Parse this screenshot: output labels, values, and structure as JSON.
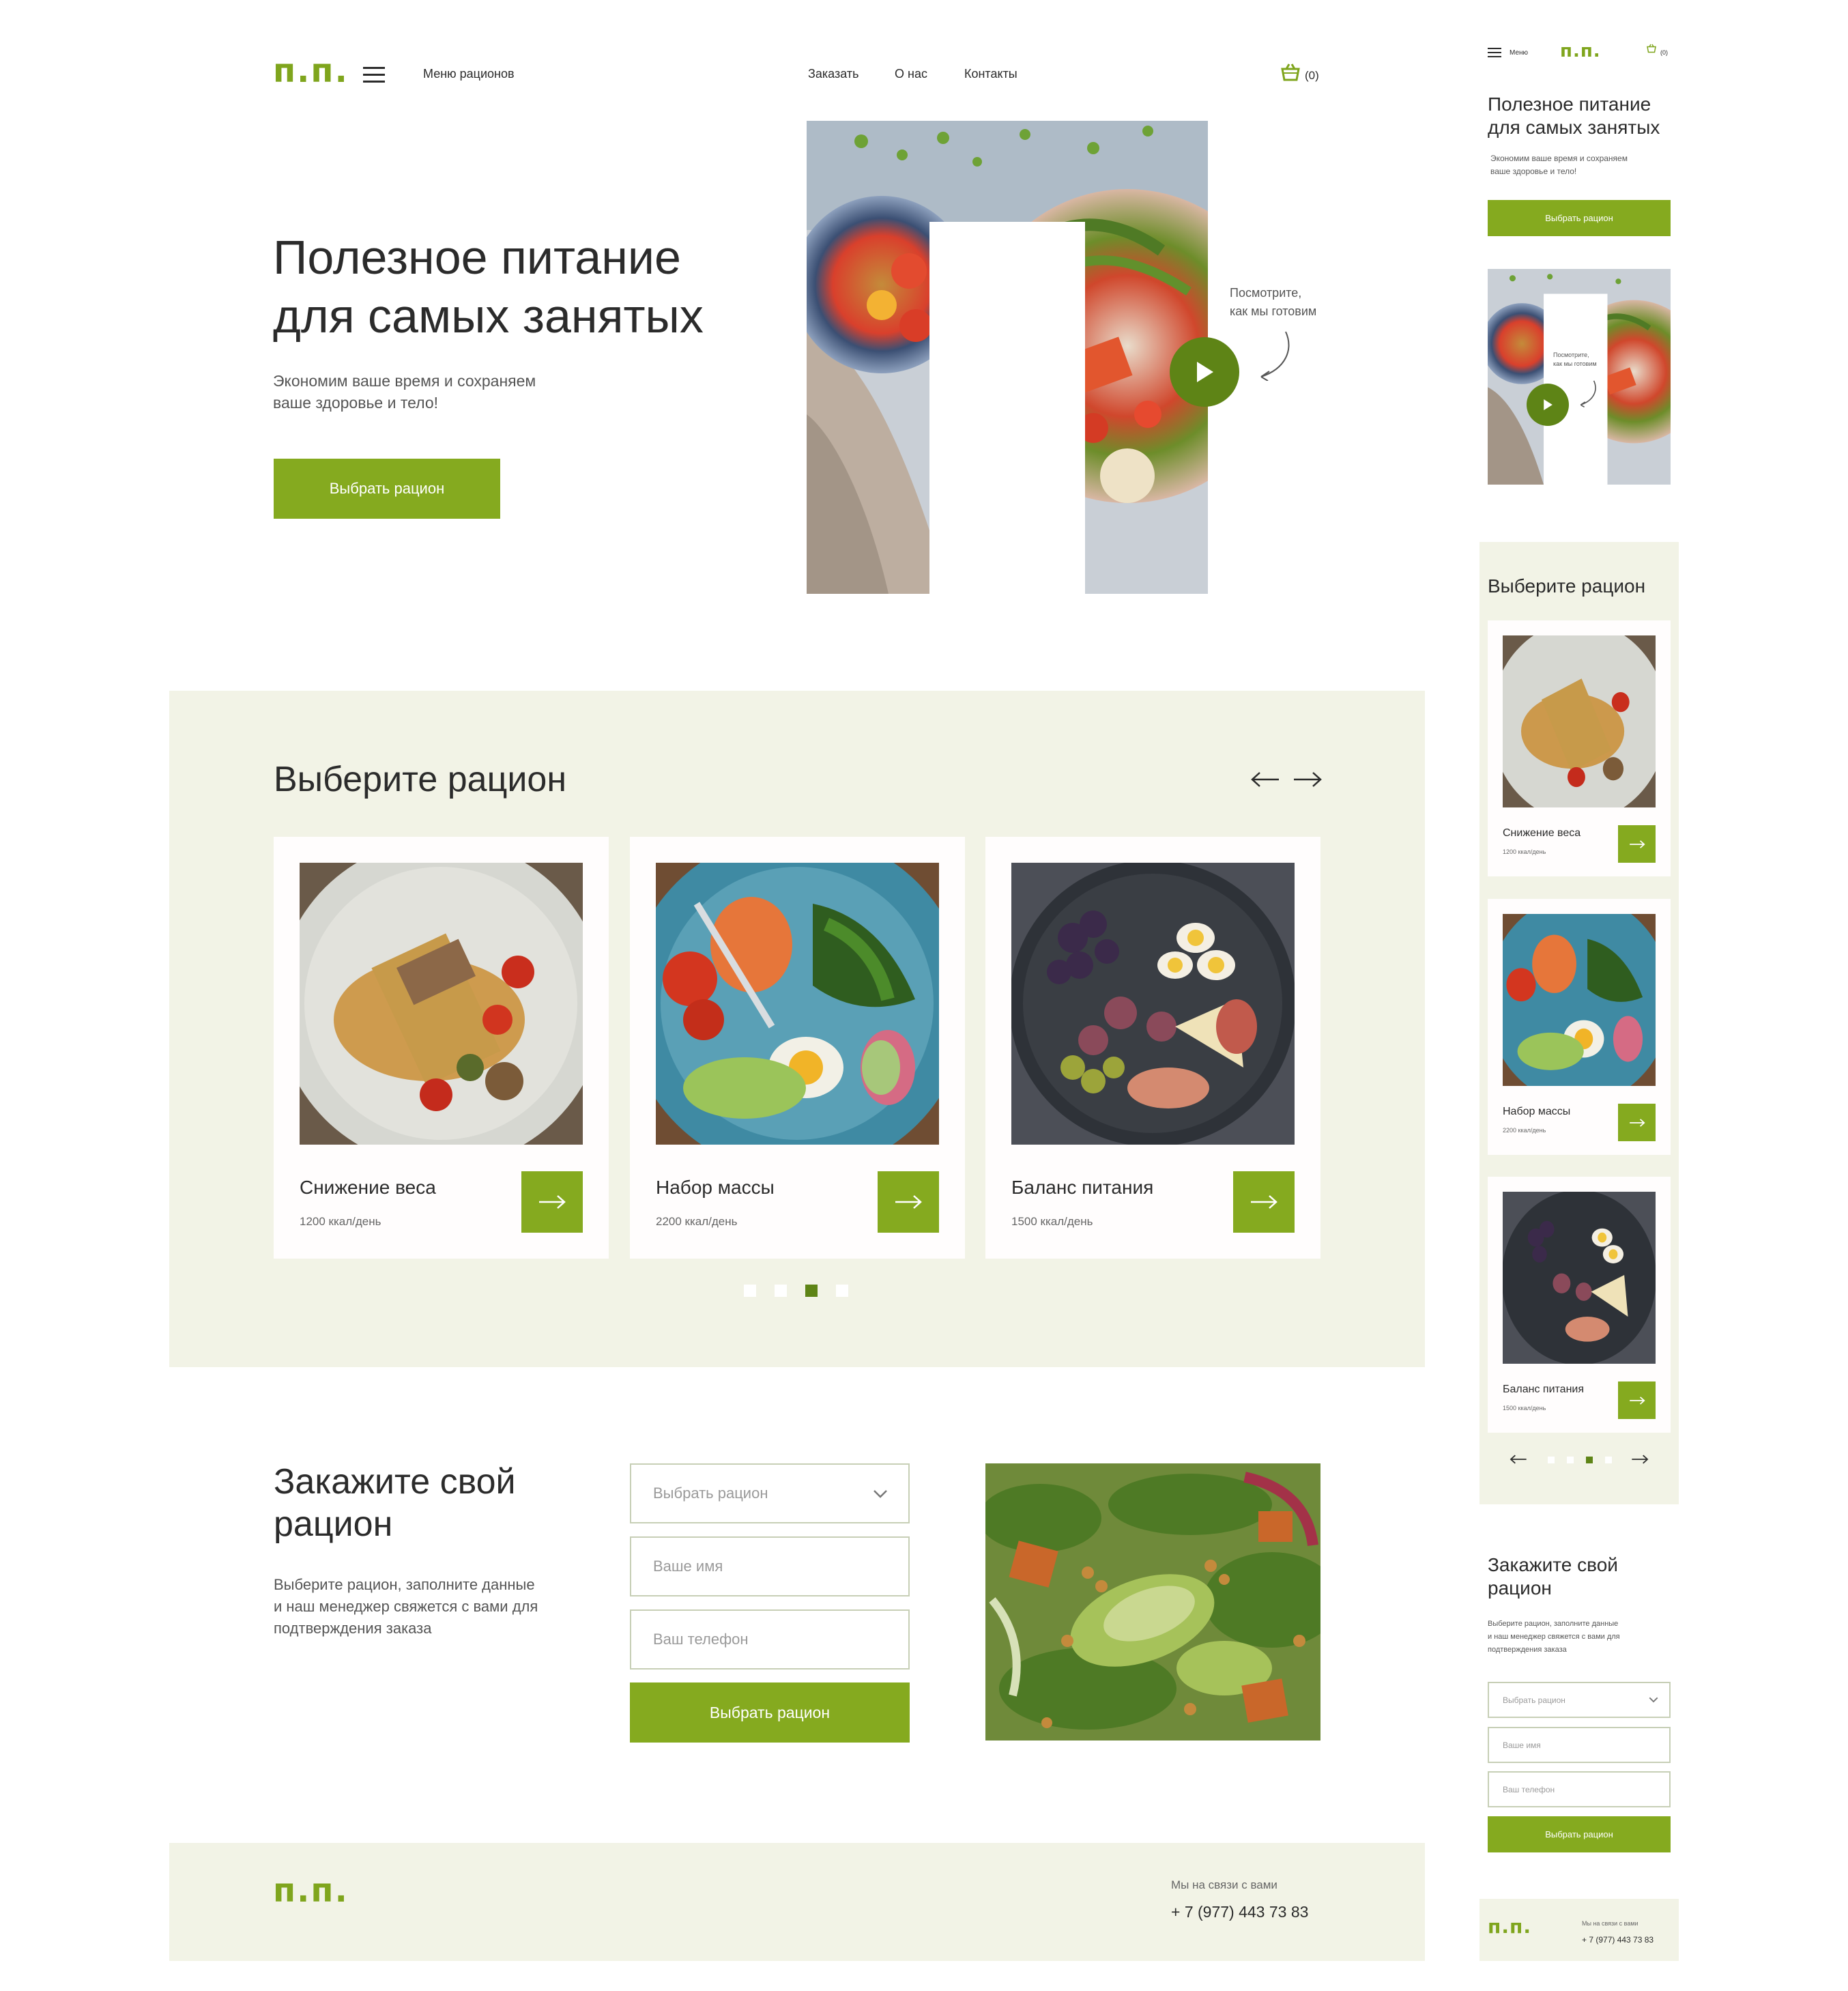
{
  "brand": {
    "logo": "п.п.",
    "accent": "#85aa1f",
    "light_bg": "#f2f3e6",
    "dark_green": "#5e8416"
  },
  "header": {
    "menu_label": "Меню рационов",
    "nav": [
      "Заказать",
      "О нас",
      "Контакты"
    ],
    "cart_count": "(0)"
  },
  "hero": {
    "title_line1": "Полезное питание",
    "title_line2": "для самых занятых",
    "subtitle_line1": "Экономим ваше время и сохраняем",
    "subtitle_line2": "ваше здоровье и тело!",
    "cta": "Выбрать рацион",
    "video_caption_line1": "Посмотрите,",
    "video_caption_line2": "как мы готовим"
  },
  "diets": {
    "title": "Выберите рацион",
    "cards": [
      {
        "name": "Снижение веса",
        "kcal": "1200 ккал/день"
      },
      {
        "name": "Набор массы",
        "kcal": "2200 ккал/день"
      },
      {
        "name": "Баланс питания",
        "kcal": "1500 ккал/день"
      }
    ],
    "dots": 4,
    "active_dot": 3
  },
  "order": {
    "title_line1": "Закажите свой",
    "title_line2": "рацион",
    "desc_line1": "Выберите рацион, заполните данные",
    "desc_line2": "и наш менеджер свяжется с вами для",
    "desc_line3": "подтверждения заказа",
    "select_placeholder": "Выбрать рацион",
    "name_placeholder": "Ваше имя",
    "phone_placeholder": "Ваш телефон",
    "submit": "Выбрать рацион"
  },
  "footer": {
    "contact_label": "Мы на связи с вами",
    "phone": "+ 7 (977) 443 73 83"
  },
  "mobile": {
    "menu_label": "Меню",
    "cart_count": "(0)",
    "hero_title_line1": "Полезное питание",
    "hero_title_line2": "для самых занятых",
    "hero_sub_line1": "Экономим ваше время и сохраняем",
    "hero_sub_line2": "ваше здоровье и тело!",
    "cta": "Выбрать рацион",
    "video_caption_line1": "Посмотрите,",
    "video_caption_line2": "как мы готовим",
    "diets_title": "Выберите рацион",
    "order_title_line1": "Закажите свой",
    "order_title_line2": "рацион",
    "order_desc_line1": "Выберите рацион, заполните данные",
    "order_desc_line2": "и наш менеджер свяжется с вами для",
    "order_desc_line3": "подтверждения заказа",
    "select_placeholder": "Выбрать рацион",
    "name_placeholder": "Ваше имя",
    "phone_placeholder": "Ваш телефон",
    "submit": "Выбрать рацион",
    "contact_label": "Мы на связи с вами",
    "phone": "+ 7 (977) 443 73 83"
  }
}
